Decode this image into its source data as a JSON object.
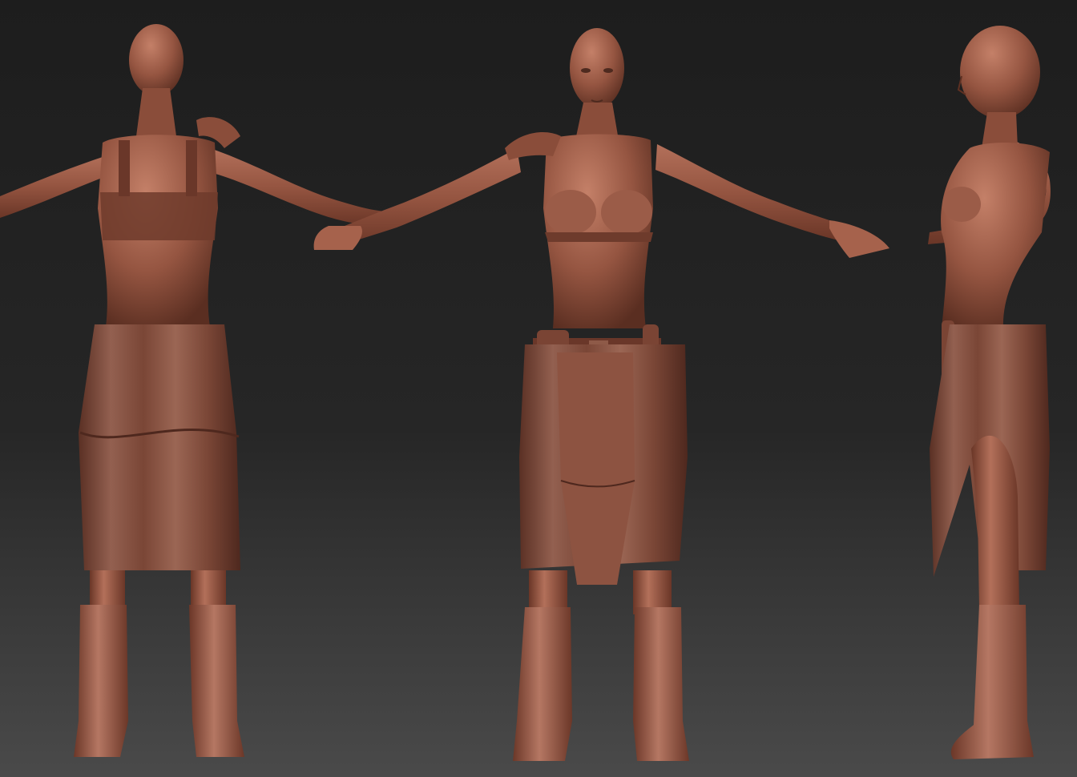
{
  "scene": {
    "description_visible_text": "",
    "views": [
      {
        "id": "back",
        "label": ""
      },
      {
        "id": "front",
        "label": ""
      },
      {
        "id": "side",
        "label": ""
      }
    ],
    "colors": {
      "background_top": "#1d1d1d",
      "background_bottom": "#4a4a4a",
      "skin": "#9a5a45",
      "skin_light": "#b87560",
      "skin_shadow": "#5e3022",
      "leather": "#8a5443",
      "leather_dark": "#5a3024"
    }
  }
}
